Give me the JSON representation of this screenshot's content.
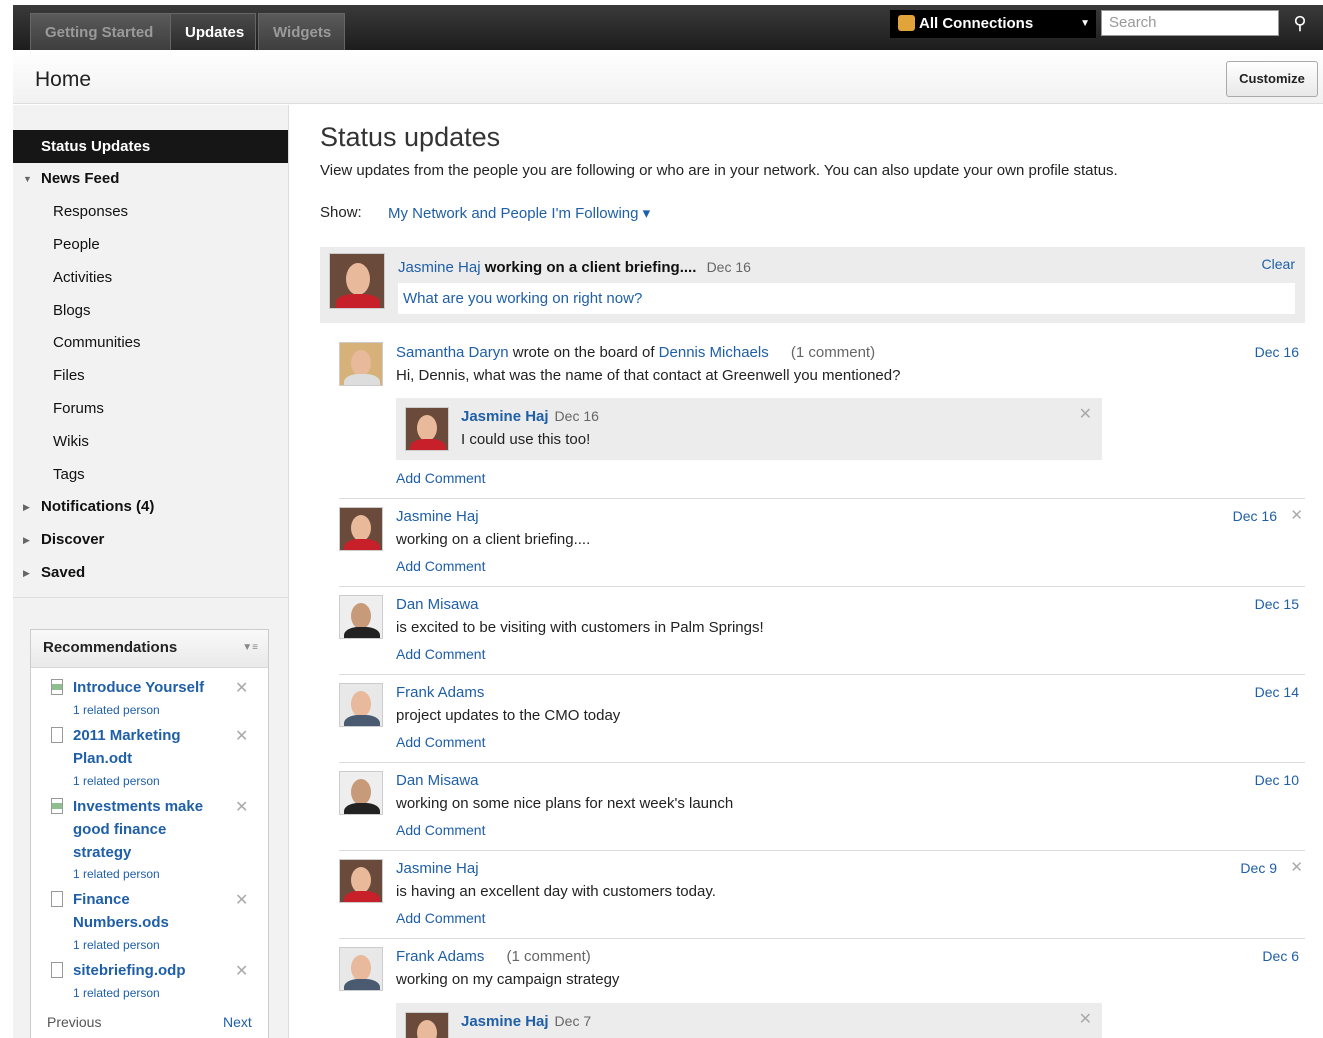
{
  "nav": {
    "tabs": [
      "Getting Started",
      "Updates",
      "Widgets"
    ],
    "active": "Updates"
  },
  "connections": {
    "label": "All Connections"
  },
  "search": {
    "placeholder": "Search"
  },
  "header": {
    "title": "Home",
    "customize": "Customize"
  },
  "sidebar": {
    "heading": "Status Updates",
    "news_feed": "News Feed",
    "items": [
      "Responses",
      "People",
      "Activities",
      "Blogs",
      "Communities",
      "Files",
      "Forums",
      "Wikis",
      "Tags"
    ],
    "notifications": "Notifications (4)",
    "discover": "Discover",
    "saved": "Saved"
  },
  "recommendations": {
    "title": "Recommendations",
    "items": [
      {
        "title": "Introduce Yourself",
        "sub": "1 related person"
      },
      {
        "title": "2011 Marketing Plan.odt",
        "sub": "1 related person"
      },
      {
        "title": "Investments make good finance strategy",
        "sub": "1 related person"
      },
      {
        "title": "Finance Numbers.ods",
        "sub": "1 related person"
      },
      {
        "title": "sitebriefing.odp",
        "sub": "1 related person"
      }
    ],
    "previous": "Previous",
    "next": "Next"
  },
  "main": {
    "title": "Status updates",
    "description": "View updates from the people you are following or who are in your network. You can also update your own profile status.",
    "show_label": "Show:",
    "show_value": "My Network and People I'm Following ▾"
  },
  "my_status": {
    "name": "Jasmine Haj",
    "text": "working on a client briefing....",
    "date": "Dec 16",
    "clear": "Clear",
    "prompt": "What are you working on right now?"
  },
  "entries": [
    {
      "name": "Samantha Daryn",
      "wrote": "wrote on the board of",
      "target": "Dennis Michaels",
      "comments": "(1 comment)",
      "text": "Hi, Dennis, what was the name of that contact at Greenwell you mentioned?",
      "date": "Dec 16",
      "add": "Add Comment",
      "comment": {
        "name": "Jasmine Haj",
        "date": "Dec 16",
        "text": "I could use this too!"
      }
    },
    {
      "name": "Jasmine Haj",
      "text": "working on a client briefing....",
      "date": "Dec 16",
      "add": "Add Comment"
    },
    {
      "name": "Dan Misawa",
      "text": "is excited to be visiting with customers in Palm Springs!",
      "date": "Dec 15",
      "add": "Add Comment"
    },
    {
      "name": "Frank Adams",
      "text": "project updates to the CMO today",
      "date": "Dec 14",
      "add": "Add Comment"
    },
    {
      "name": "Dan Misawa",
      "text": "working on some nice plans for next week's launch",
      "date": "Dec 10",
      "add": "Add Comment"
    },
    {
      "name": "Jasmine Haj",
      "text": "is having an excellent day with customers today.",
      "date": "Dec 9",
      "add": "Add Comment"
    },
    {
      "name": "Frank Adams",
      "comments": "(1 comment)",
      "text": "working on my campaign strategy",
      "date": "Dec 6",
      "comment": {
        "name": "Jasmine Haj",
        "date": "Dec 7"
      }
    }
  ],
  "icons": {
    "connections": "connections-icon",
    "search": "search-icon",
    "close": "close-icon",
    "doc": "document-icon"
  }
}
